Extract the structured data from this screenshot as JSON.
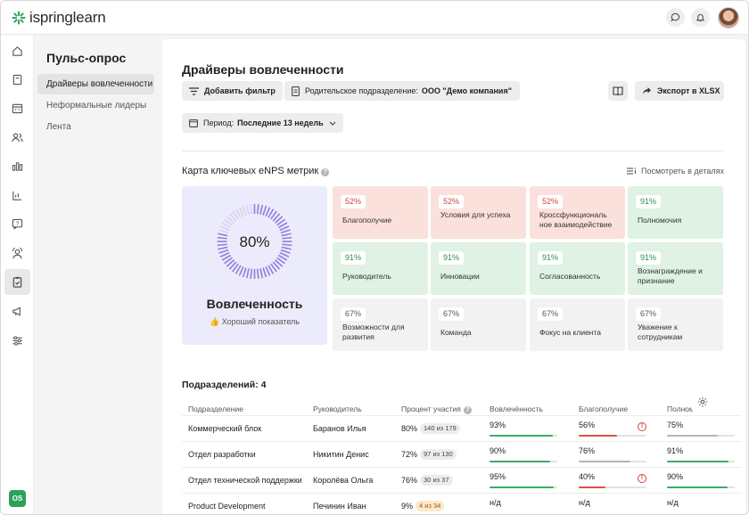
{
  "app": {
    "logo_text": "ispringlearn"
  },
  "sidebar_nav": {
    "icons": [
      "home-icon",
      "book-icon",
      "calendar-icon",
      "users-icon",
      "stats-icon",
      "chart-icon",
      "question-icon",
      "person-settings-icon",
      "clipboard-icon",
      "megaphone-icon",
      "sliders-icon"
    ],
    "active": "clipboard-icon",
    "account_badge": "OS"
  },
  "submenu": {
    "title": "Пульс-опрос",
    "items": [
      {
        "label": "Драйверы вовлеченности",
        "active": true
      },
      {
        "label": "Неформальные лидеры",
        "active": false
      },
      {
        "label": "Лента",
        "active": false
      }
    ]
  },
  "page": {
    "title": "Драйверы вовлеченности",
    "add_filter": "Добавить фильтр",
    "parent_label": "Родительское подразделение:",
    "parent_value": "ООО \"Демо компания\"",
    "export_label": "Экспорт в XLSX",
    "period_label": "Период:",
    "period_value": "Последние 13 недель"
  },
  "metrics": {
    "title": "Карта ключевых eNPS метрик",
    "details_link": "Посмотреть в деталях",
    "engagement": {
      "value": "80%",
      "percent": 80,
      "title": "Вовлеченность",
      "subtitle": "Хороший показатель"
    },
    "tiles": [
      {
        "value": "52%",
        "label": "Благополучие",
        "status": "red"
      },
      {
        "value": "52%",
        "label": "Условия для успеха",
        "status": "red"
      },
      {
        "value": "52%",
        "label": "Кроссфункциональ ное взаимодействие",
        "status": "red"
      },
      {
        "value": "91%",
        "label": "Полномочия",
        "status": "green"
      },
      {
        "value": "91%",
        "label": "Руководитель",
        "status": "green"
      },
      {
        "value": "91%",
        "label": "Инновации",
        "status": "green"
      },
      {
        "value": "91%",
        "label": "Согласованность",
        "status": "green"
      },
      {
        "value": "91%",
        "label": "Вознаграждение и признание",
        "status": "green"
      },
      {
        "value": "67%",
        "label": "Возможности для развития",
        "status": "gray"
      },
      {
        "value": "67%",
        "label": "Команда",
        "status": "gray"
      },
      {
        "value": "67%",
        "label": "Фокус на клиента",
        "status": "gray"
      },
      {
        "value": "67%",
        "label": "Уважение к сотрудникам",
        "status": "gray"
      }
    ]
  },
  "departments": {
    "title": "Подразделений: 4",
    "columns": [
      "Подразделение",
      "Руководитель",
      "Процент участия",
      "Вовлечённость",
      "Благополучие",
      "Полномо"
    ],
    "rows": [
      {
        "name": "Коммерческий блок",
        "head": "Баранов Илья",
        "participation": "80%",
        "count": "140 из 179",
        "count_warn": false,
        "engagement": "93%",
        "engagement_pct": 93,
        "engagement_color": "#3aae64",
        "wellbeing": "56%",
        "wellbeing_pct": 56,
        "wellbeing_color": "#e0533f",
        "wellbeing_alert": true,
        "authority": "75%",
        "authority_pct": 75,
        "authority_color": "#b5b5b5"
      },
      {
        "name": "Отдел разработки",
        "head": "Никитин Денис",
        "participation": "72%",
        "count": "97 из 130",
        "count_warn": false,
        "engagement": "90%",
        "engagement_pct": 90,
        "engagement_color": "#3aae64",
        "wellbeing": "76%",
        "wellbeing_pct": 76,
        "wellbeing_color": "#b5b5b5",
        "wellbeing_alert": false,
        "authority": "91%",
        "authority_pct": 91,
        "authority_color": "#3aae64"
      },
      {
        "name": "Отдел технической поддержки",
        "head": "Королёва Ольга",
        "participation": "76%",
        "count": "30 из 37",
        "count_warn": false,
        "engagement": "95%",
        "engagement_pct": 95,
        "engagement_color": "#3aae64",
        "wellbeing": "40%",
        "wellbeing_pct": 40,
        "wellbeing_color": "#e0533f",
        "wellbeing_alert": true,
        "authority": "90%",
        "authority_pct": 90,
        "authority_color": "#3aae64"
      },
      {
        "name": "Product Development",
        "head": "Печинин Иван",
        "participation": "9%",
        "count": "4 из 34",
        "count_warn": true,
        "engagement": "н/д",
        "engagement_pct": 0,
        "engagement_color": "#e2e2e2",
        "wellbeing": "н/д",
        "wellbeing_pct": 0,
        "wellbeing_color": "#e2e2e2",
        "wellbeing_alert": false,
        "authority": "н/д",
        "authority_pct": 0,
        "authority_color": "#e2e2e2"
      }
    ]
  },
  "colors": {
    "brand": "#2ca15a",
    "engagement_bg": "#ecebfb",
    "ring": "#8e7fdc",
    "negative": "#d0453a",
    "positive": "#2a8f4f"
  }
}
